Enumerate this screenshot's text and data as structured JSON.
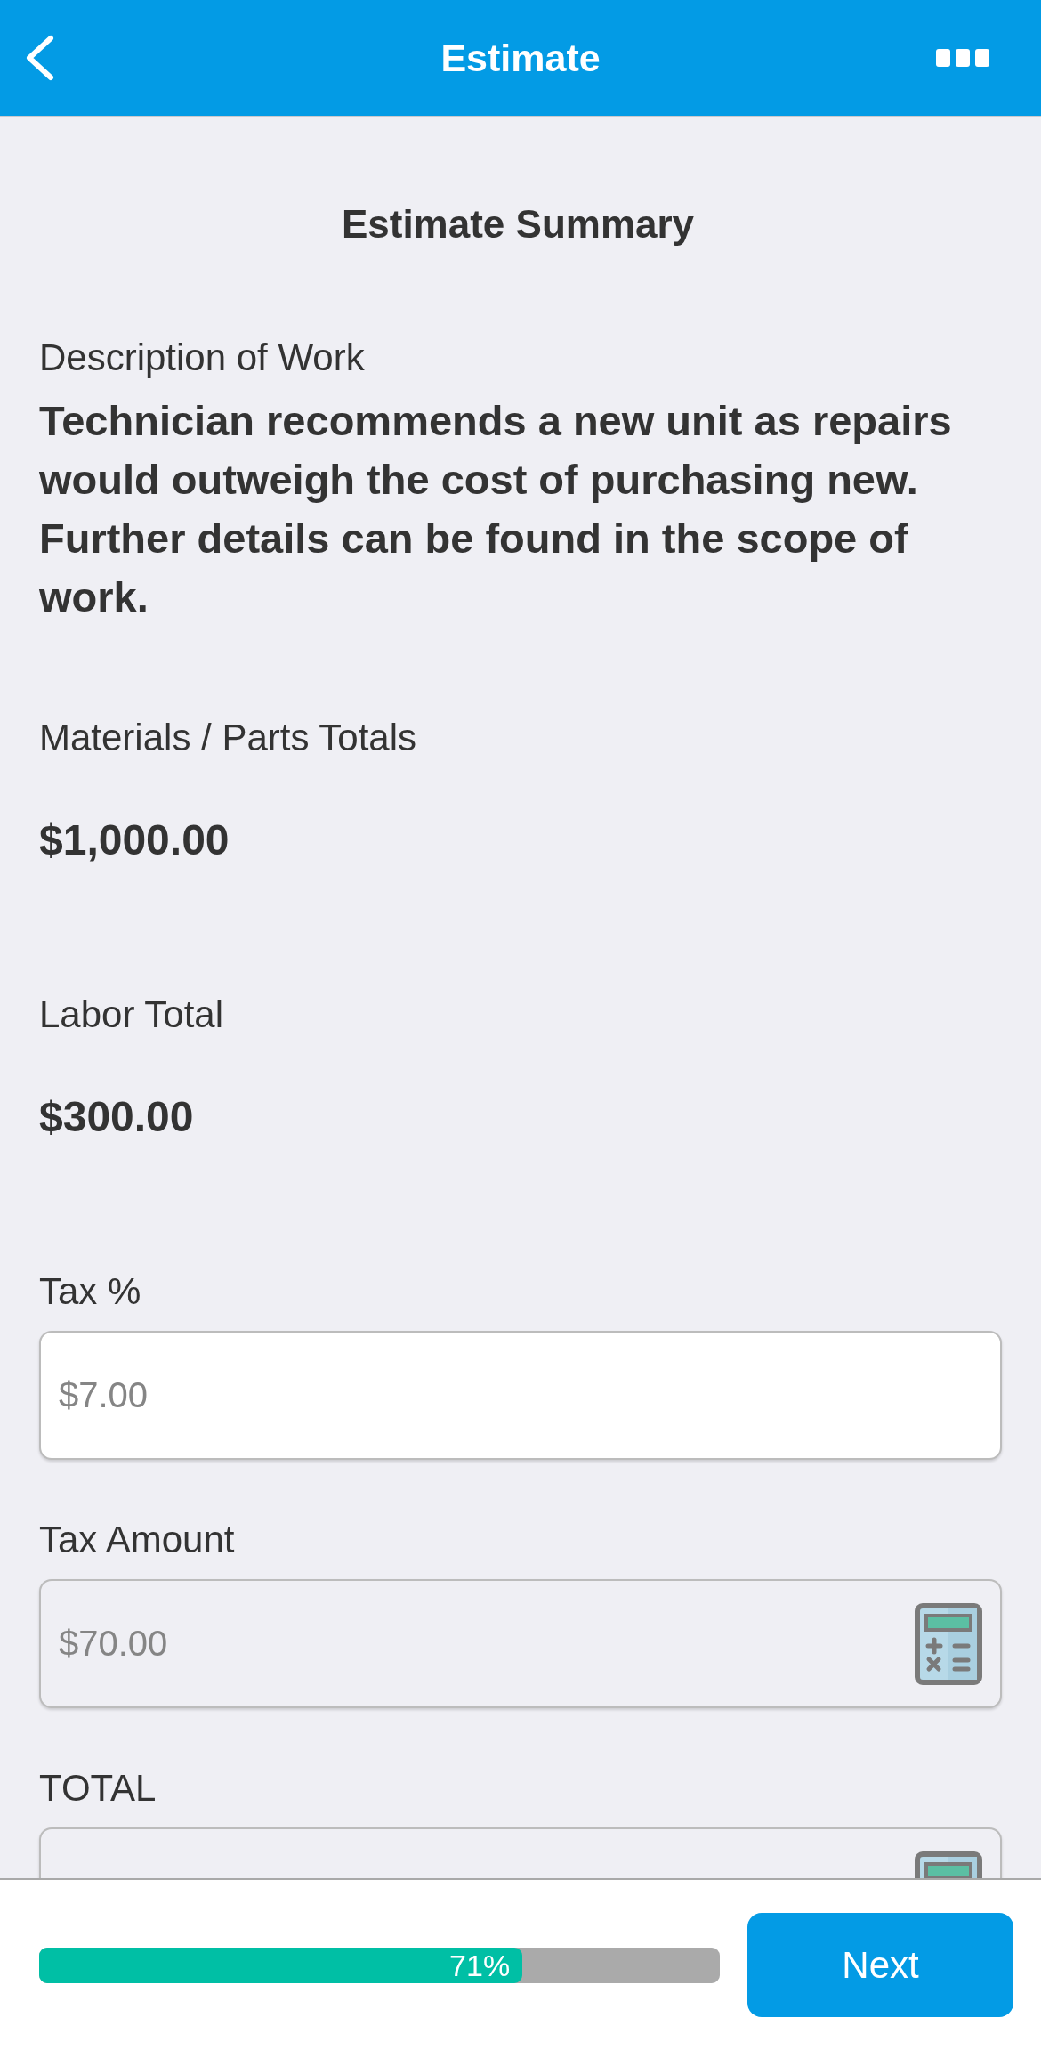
{
  "header": {
    "title": "Estimate"
  },
  "summary": {
    "title": "Estimate Summary",
    "sections": [
      {
        "kind": "text",
        "label": "Description of Work",
        "value": "Technician recommends a new unit as repairs would outweigh the cost of purchasing new. Further details can be found in the scope of work."
      },
      {
        "kind": "amount",
        "label": "Materials / Parts Totals",
        "value": "$1,000.00"
      },
      {
        "kind": "amount",
        "label": "Labor Total",
        "value": "$300.00"
      },
      {
        "kind": "field",
        "label": "Tax %",
        "placeholder": "$7.00",
        "disabled": false,
        "calculator": false
      },
      {
        "kind": "field",
        "label": "Tax Amount",
        "placeholder": "$70.00",
        "disabled": true,
        "calculator": true
      },
      {
        "kind": "field",
        "label": "TOTAL",
        "disabled": true,
        "calculator": true
      }
    ]
  },
  "footer": {
    "progress": {
      "level": 0.71,
      "reading": "71%"
    },
    "button": "Next"
  }
}
